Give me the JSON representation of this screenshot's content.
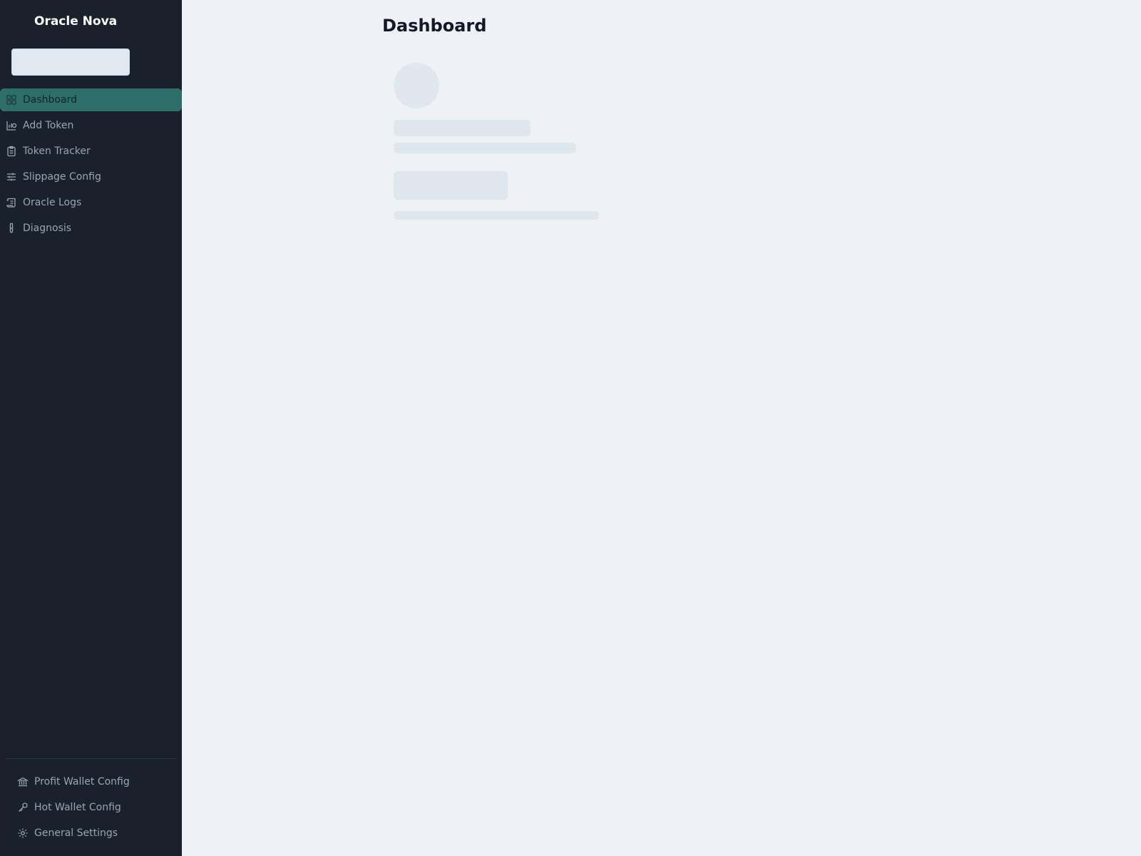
{
  "app": {
    "title": "Oracle Nova"
  },
  "search": {
    "value": "",
    "placeholder": ""
  },
  "sidebar": {
    "items": [
      {
        "label": "Dashboard",
        "icon": "dashboard-grid-icon",
        "active": true
      },
      {
        "label": "Add Token",
        "icon": "chart-add-icon",
        "active": false
      },
      {
        "label": "Token Tracker",
        "icon": "clipboard-icon",
        "active": false
      },
      {
        "label": "Slippage Config",
        "icon": "sliders-icon",
        "active": false
      },
      {
        "label": "Oracle Logs",
        "icon": "scroll-icon",
        "active": false
      },
      {
        "label": "Diagnosis",
        "icon": "test-tube-icon",
        "active": false
      }
    ],
    "bottom_items": [
      {
        "label": "Profit Wallet Config",
        "icon": "bank-icon"
      },
      {
        "label": "Hot Wallet Config",
        "icon": "key-icon"
      },
      {
        "label": "General Settings",
        "icon": "gear-icon"
      }
    ]
  },
  "main": {
    "title": "Dashboard",
    "state": "loading"
  },
  "colors": {
    "sidebar_bg": "#1b212c",
    "active_item_bg": "#2e6e6a",
    "page_bg": "#eef2f7",
    "skeleton": "#e0e6ee",
    "nav_text": "#9aa4b2"
  }
}
